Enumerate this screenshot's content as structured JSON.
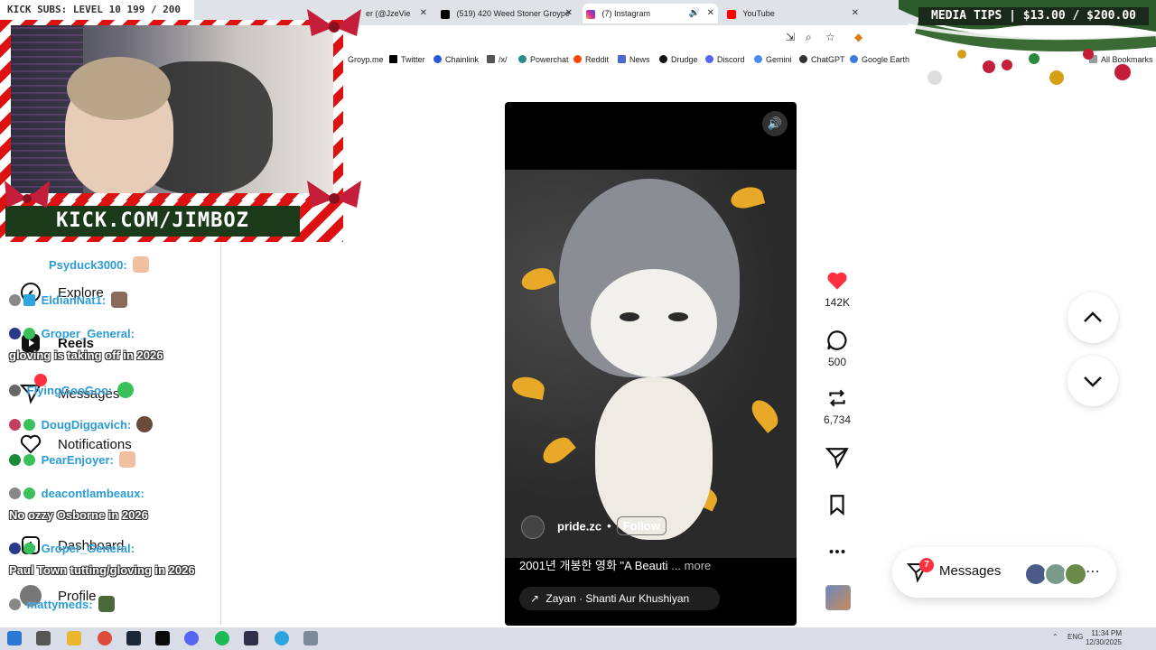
{
  "browser": {
    "tabs": [
      {
        "label": "er (@JzeVie"
      },
      {
        "label": "(519) 420 Weed Stoner Groype"
      },
      {
        "label": "(7) Instagram"
      },
      {
        "label": "YouTube"
      }
    ],
    "bookmarks": [
      "Groyp.me",
      "Twitter",
      "Chainlink",
      "/x/",
      "Powerchat",
      "Reddit",
      "News",
      "Drudge",
      "Discord",
      "Gemini",
      "ChatGPT",
      "Google Earth"
    ],
    "all_bookmarks": "All Bookmarks"
  },
  "overlay": {
    "kick_subs": "KICK SUBS: LEVEL 10 199 / 200",
    "media_tips": "MEDIA TIPS | $13.00 / $200.00",
    "kick_url": "KICK.COM/JIMBOZ"
  },
  "ig_nav": {
    "items": [
      {
        "label": "Explore"
      },
      {
        "label": "Reels"
      },
      {
        "label": "Messages"
      },
      {
        "label": "Notifications"
      },
      {
        "label": "Dashboard"
      },
      {
        "label": "Profile"
      }
    ]
  },
  "chat": [
    {
      "user": "Psyduck3000:",
      "msg": ""
    },
    {
      "user": "EldianNat1:",
      "msg": ""
    },
    {
      "user": "Groper_General:",
      "msg": "gloving is taking off in 2026"
    },
    {
      "user": "FlyingGooGoo:",
      "msg": ""
    },
    {
      "user": "DougDiggavich:",
      "msg": ""
    },
    {
      "user": "PearEnjoyer:",
      "msg": ""
    },
    {
      "user": "deacontlambeaux:",
      "msg": "No ozzy Osborne in 2026"
    },
    {
      "user": "Groper_General:",
      "msg": "Paul Town tutting/gloving in 2026"
    },
    {
      "user": "mattymeds:",
      "msg": ""
    }
  ],
  "reel": {
    "username": "pride.zc",
    "dot": "•",
    "follow": "Follow",
    "caption": "2001년 개봉한 영화 \"A Beauti",
    "caption_more": "... more",
    "audio": "Zayan · Shanti Aur Khushiyan",
    "audio_icon": "↗"
  },
  "actions": {
    "likes": "142K",
    "comments": "500",
    "reposts": "6,734"
  },
  "messages": {
    "label": "Messages",
    "badge": "7"
  },
  "taskbar": {
    "lang": "ENG",
    "time": "11:34 PM",
    "date": "12/30/2025"
  },
  "colors": {
    "like_red": "#ff3040",
    "chat_blue": "#2b9bd6",
    "badge_red": "#ff3040"
  }
}
